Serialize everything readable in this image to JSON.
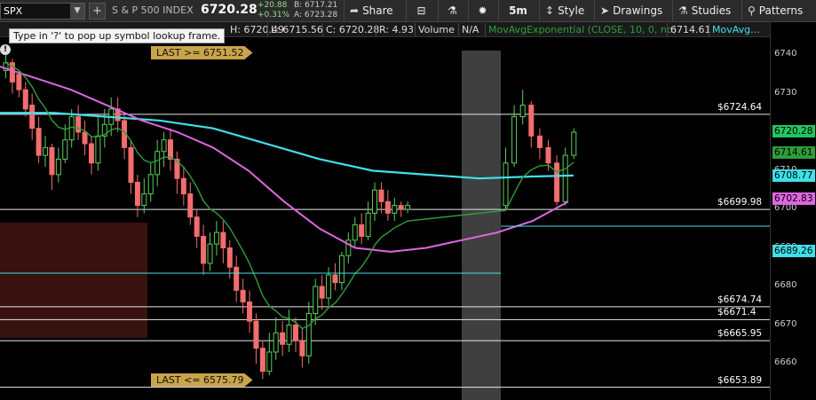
{
  "toolbar": {
    "symbol": "SPX",
    "description": "S & P 500 INDEX",
    "last": "6720.28",
    "net_change": "+20.88",
    "pct_change": "+0.31%",
    "bid": "B: 6717.21",
    "ask": "A: 6723.28",
    "share_label": "Share",
    "timeframe_label": "5m",
    "style_label": "Style",
    "drawings_label": "Drawings",
    "studies_label": "Studies",
    "patterns_label": "Patterns"
  },
  "study_header": {
    "high": "H: 6720.49",
    "low": "L: 6715.56",
    "close": "C: 6720.28",
    "range": "R: 4.93",
    "volume_label": "Volume",
    "volume_value": "N/A",
    "ema_label": "MovAvgExponential (CLOSE, 10, 0, no)",
    "ema_value": "6714.61",
    "more_label": "MovAvg..."
  },
  "tooltip": "Type in '?' to pop up symbol lookup frame.",
  "info_glyph": "!",
  "alerts": {
    "upper": "LAST >= 6751.52",
    "lower": "LAST <= 6575.79"
  },
  "price_levels": [
    "$6724.64",
    "$6699.98",
    "$6674.74",
    "$6671.4",
    "$6665.95",
    "$6653.89"
  ],
  "axis": {
    "ticks": [
      "6740",
      "6730",
      "6720",
      "6710",
      "6700",
      "6690",
      "6680",
      "6670",
      "6660"
    ],
    "tags": [
      {
        "text": "6720.28",
        "color": "#22c55e"
      },
      {
        "text": "6714.61",
        "color": "#2e9e3a"
      },
      {
        "text": "6708.77",
        "color": "#40e0e8"
      },
      {
        "text": "6702.83",
        "color": "#e066e0"
      },
      {
        "text": "6689.26",
        "color": "#40e0e8"
      }
    ]
  },
  "colors": {
    "up": "#5ccf5c",
    "down": "#f26d6d",
    "ema10": "#2e9e3a",
    "ma_cyan": "#40e0e8",
    "ma_magenta": "#e066e0",
    "alert": "#c9a44a"
  },
  "icons": [
    "dropdown-arrow-icon",
    "plus-icon",
    "share-icon",
    "active-trader-icon",
    "flask-icon",
    "gear-icon",
    "style-icon",
    "cursor-icon",
    "flask-studies-icon",
    "patterns-icon",
    "settings-icon"
  ]
}
